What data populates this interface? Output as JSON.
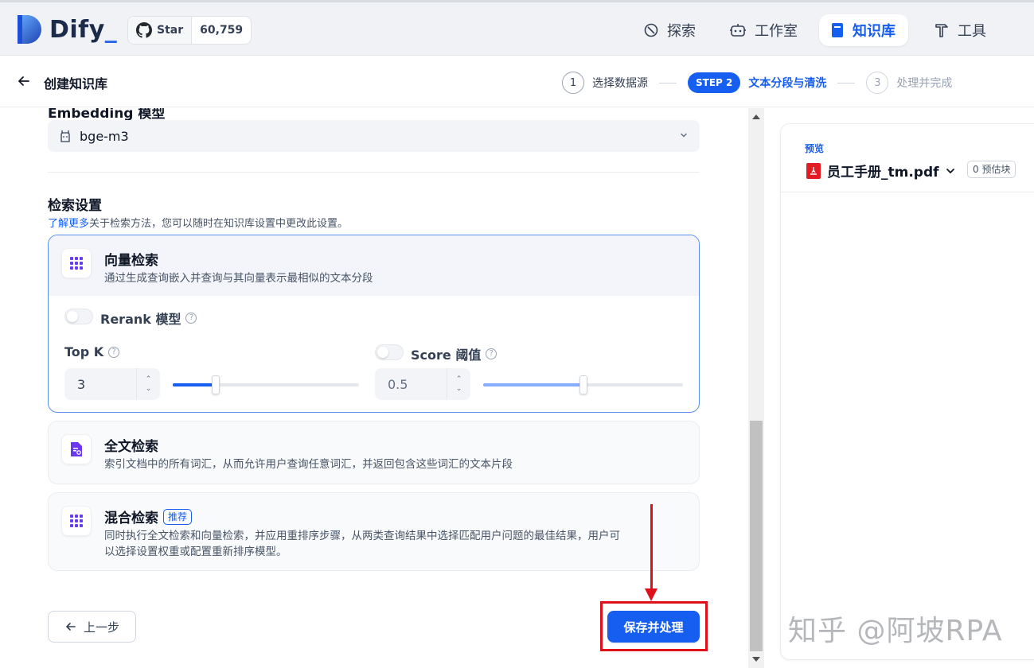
{
  "app": {
    "logo_text": "Dify",
    "logo_underscore": "_"
  },
  "github": {
    "star_label": "Star",
    "star_count": "60,759"
  },
  "nav": {
    "explore": "探索",
    "studio": "工作室",
    "knowledge": "知识库",
    "tools": "工具"
  },
  "subheader": {
    "title": "创建知识库",
    "steps": [
      {
        "num": "1",
        "label": "选择数据源"
      },
      {
        "pill": "STEP 2",
        "label": "文本分段与清洗"
      },
      {
        "num": "3",
        "label": "处理并完成"
      }
    ]
  },
  "embedding": {
    "label": "Embedding 模型",
    "model": "bge-m3"
  },
  "retrieval": {
    "title": "检索设置",
    "desc_link": "了解更多",
    "desc_rest": "关于检索方法，您可以随时在知识库设置中更改此设置。",
    "vector": {
      "title": "向量检索",
      "desc": "通过生成查询嵌入并查询与其向量表示最相似的文本分段",
      "rerank_label": "Rerank 模型",
      "topk_label": "Top K",
      "topk_value": "3",
      "topk_level": 0.23,
      "score_label": "Score 阈值",
      "score_value": "0.5",
      "score_level": 0.5
    },
    "fulltext": {
      "title": "全文检索",
      "desc": "索引文档中的所有词汇，从而允许用户查询任意词汇，并返回包含这些词汇的文本片段"
    },
    "hybrid": {
      "title": "混合检索",
      "badge": "推荐",
      "desc_line1": "同时执行全文检索和向量检索，并应用重排序步骤，从两类查询结果中选择匹配用户问题的最佳结果，用户可",
      "desc_line2": "以选择设置权重或配置重新排序模型。"
    }
  },
  "buttons": {
    "prev": "上一步",
    "save": "保存并处理"
  },
  "preview": {
    "label": "预览",
    "file": "员工手册_tm.pdf",
    "count": "0 预估块"
  },
  "watermark": "知乎 @阿坡RPA",
  "colors": {
    "primary": "#155eef",
    "annotation": "#e0101a"
  }
}
